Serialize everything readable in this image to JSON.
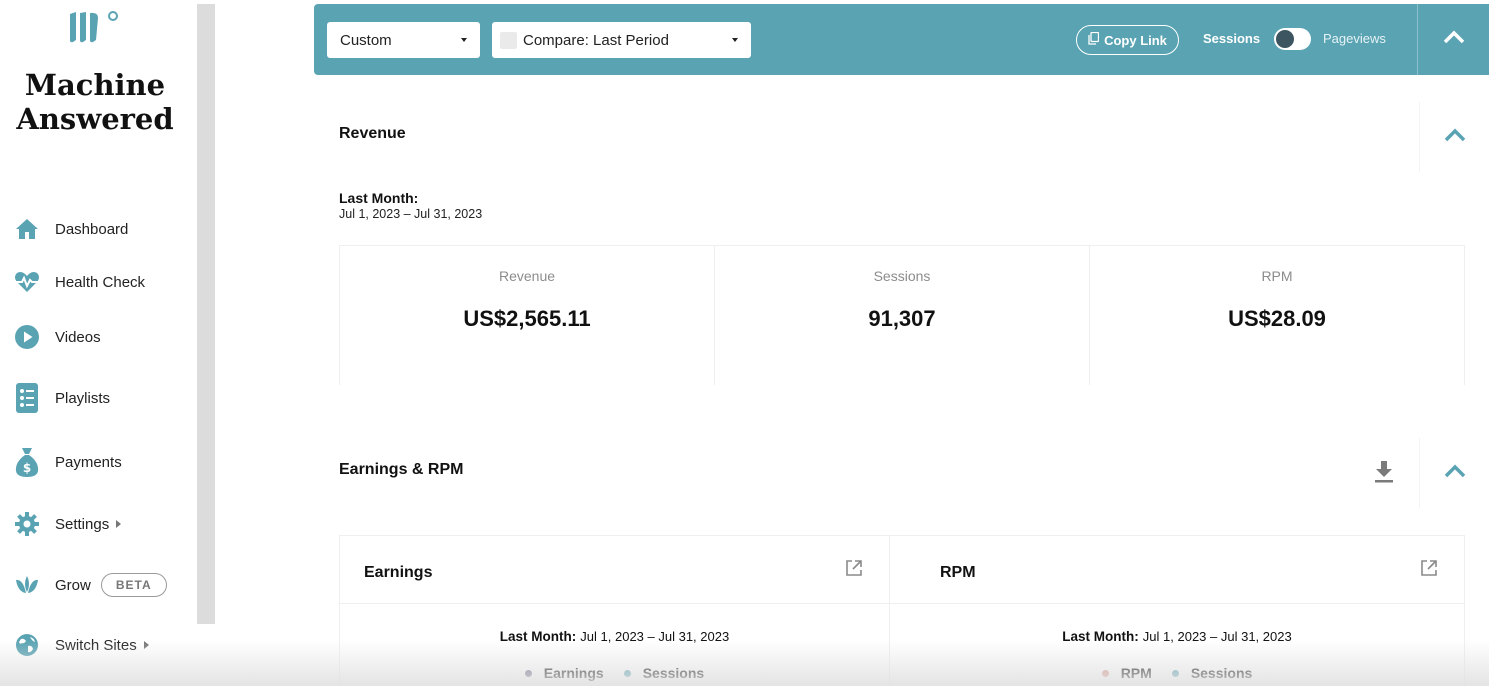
{
  "brand": {
    "line1": "Machine",
    "line2": "Answered"
  },
  "colors": {
    "accent": "#5aa3b3",
    "earnings_dot": "#6b6a86",
    "sessions_dot": "#5aa3b3",
    "rpm_dot": "#d9968a"
  },
  "sidebar": {
    "items": [
      {
        "label": "Dashboard",
        "icon": "home-icon"
      },
      {
        "label": "Health Check",
        "icon": "heartbeat-icon"
      },
      {
        "label": "Videos",
        "icon": "play-circle-icon"
      },
      {
        "label": "Playlists",
        "icon": "list-icon"
      },
      {
        "label": "Payments",
        "icon": "money-bag-icon"
      },
      {
        "label": "Settings",
        "icon": "gear-icon"
      },
      {
        "label": "Grow",
        "icon": "leaf-icon",
        "badge": "BETA"
      },
      {
        "label": "Switch Sites",
        "icon": "globe-icon"
      }
    ]
  },
  "topbar": {
    "date_range": "Custom",
    "compare": "Compare: Last Period",
    "copy_link": "Copy Link",
    "toggle_left": "Sessions",
    "toggle_right": "Pageviews"
  },
  "revenue": {
    "title": "Revenue",
    "period_label": "Last Month:",
    "period_range": "Jul 1, 2023 – Jul 31, 2023",
    "metrics": [
      {
        "label": "Revenue",
        "value": "US$2,565.11"
      },
      {
        "label": "Sessions",
        "value": "91,307"
      },
      {
        "label": "RPM",
        "value": "US$28.09"
      }
    ]
  },
  "earnings_rpm": {
    "title": "Earnings & RPM",
    "cards": [
      {
        "title": "Earnings",
        "period_label": "Last Month:",
        "period_range": "Jul 1, 2023 – Jul 31, 2023",
        "legend": [
          "Earnings",
          "Sessions"
        ]
      },
      {
        "title": "RPM",
        "period_label": "Last Month:",
        "period_range": "Jul 1, 2023 – Jul 31, 2023",
        "legend": [
          "RPM",
          "Sessions"
        ]
      }
    ]
  }
}
